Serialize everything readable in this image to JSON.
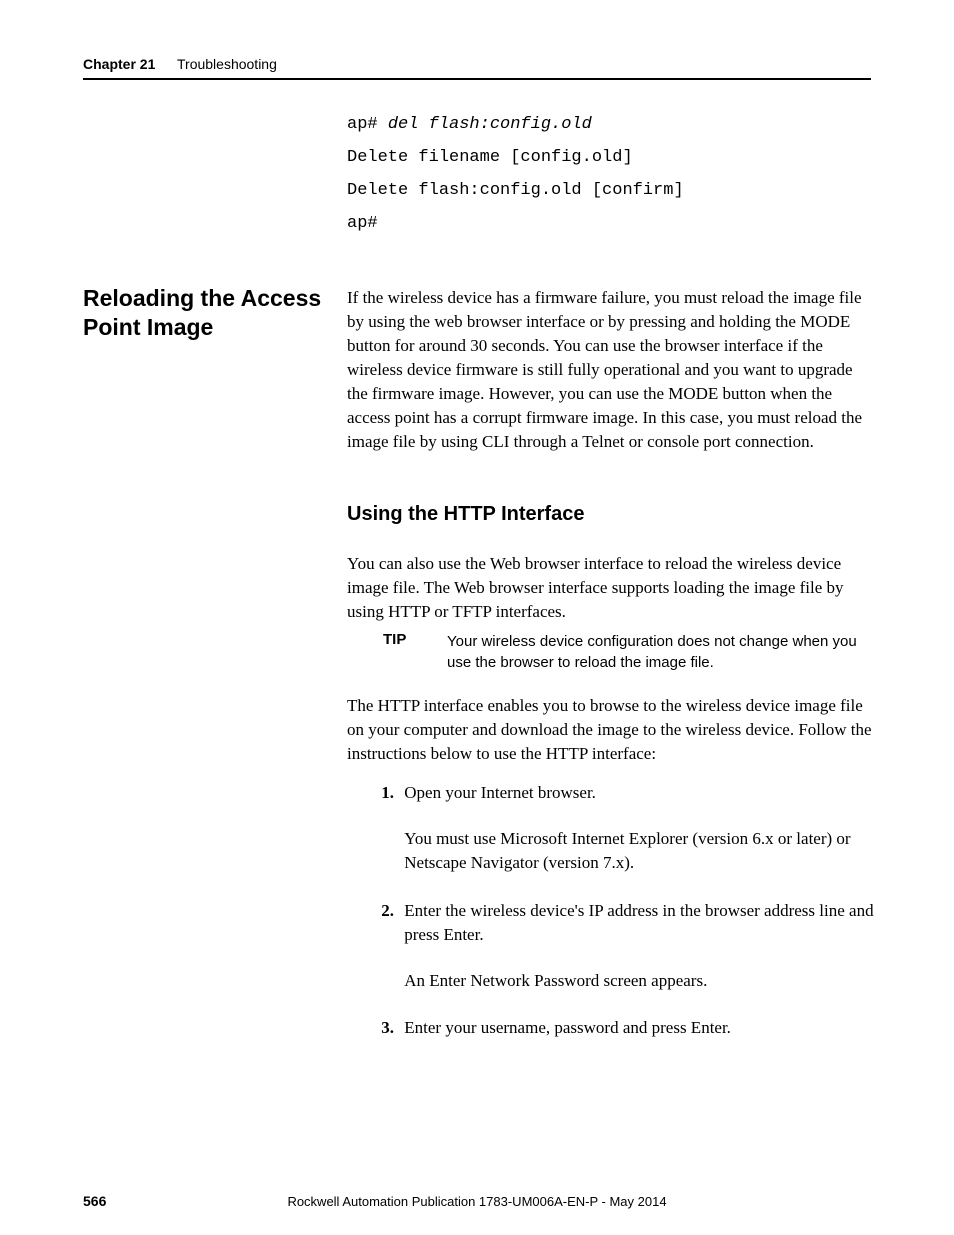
{
  "header": {
    "chapter_label": "Chapter 21",
    "chapter_title": "Troubleshooting"
  },
  "code": {
    "line1_prefix": "ap# ",
    "line1_cmd": "del flash:config.old",
    "line2": "Delete filename [config.old]",
    "line3": "Delete flash:config.old [confirm]",
    "line4": "ap#"
  },
  "side_heading": "Reloading the Access Point Image",
  "para1": "If the wireless device has a firmware failure, you must reload the image file by using the web browser interface or by pressing and holding the MODE button for around 30 seconds. You can use the browser interface if the wireless device firmware is still fully operational and you want to upgrade the firmware image. However, you can use the MODE button when the access point has a corrupt firmware image. In this case, you must reload the image file by using CLI through a Telnet or console port connection.",
  "subheading": "Using the HTTP Interface",
  "para2": "You can also use the Web browser interface to reload the wireless device image file. The Web browser interface supports loading the image file by using HTTP or TFTP interfaces.",
  "tip": {
    "label": "TIP",
    "text": "Your wireless device configuration does not change when you use the browser to reload the image file."
  },
  "para3": "The HTTP interface enables you to browse to the wireless device image file on your computer and download the image to the wireless device. Follow the instructions below to use the HTTP interface:",
  "steps": {
    "s1_num": "1.",
    "s1_text": "Open your Internet browser.",
    "s1_sub": "You must use Microsoft Internet Explorer (version 6.x or later) or Netscape Navigator (version 7.x).",
    "s2_num": "2.",
    "s2_text": "Enter the wireless device's IP address in the browser address line and press Enter.",
    "s2_sub": "An Enter Network Password screen appears.",
    "s3_num": "3.",
    "s3_text": "Enter your username, password and press Enter."
  },
  "footer": {
    "page": "566",
    "publication": "Rockwell Automation Publication 1783-UM006A-EN-P - May 2014"
  }
}
